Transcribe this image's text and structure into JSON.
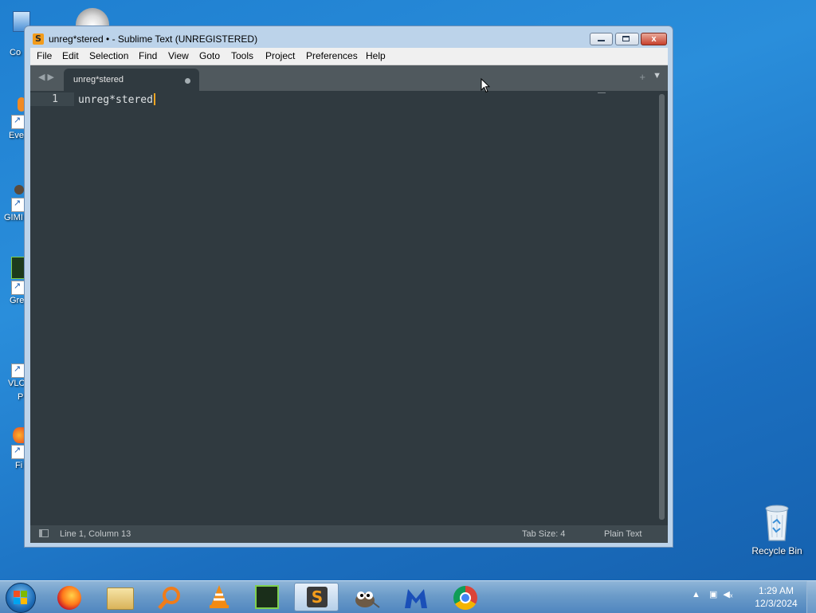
{
  "desktop": {
    "left_icons": [
      {
        "label": "Co",
        "icon": "computer-icon"
      },
      {
        "label": "Eve",
        "icon": "everything-icon"
      },
      {
        "label": "GIMI",
        "icon": "gimp-icon"
      },
      {
        "label": "Gre",
        "icon": "greenshot-icon"
      },
      {
        "label": "VLC",
        "label2": "P",
        "icon": "vlc-icon"
      },
      {
        "label": "Fi",
        "icon": "firefox-icon"
      }
    ],
    "recycle_bin": {
      "label": "Recycle Bin",
      "icon": "recycle-bin-icon"
    }
  },
  "window": {
    "title": "unreg*stered • - Sublime Text (UNREGISTERED)",
    "close_glyph": "x"
  },
  "menu": [
    "File",
    "Edit",
    "Selection",
    "Find",
    "View",
    "Goto",
    "Tools",
    "Project",
    "Preferences",
    "Help"
  ],
  "tabs": [
    {
      "label": "unreg*stered",
      "dirty": true
    }
  ],
  "editor": {
    "line_number": "1",
    "line_text": "unreg*stered"
  },
  "status": {
    "position": "Line 1, Column 13",
    "tab_size": "Tab Size: 4",
    "syntax": "Plain Text"
  },
  "taskbar": {
    "apps": [
      "firefox",
      "file-explorer",
      "search-everything",
      "vlc",
      "greenshot",
      "sublime-text",
      "gimp",
      "malwarebytes",
      "chrome"
    ],
    "active_app": "sublime-text"
  },
  "clock": {
    "time": "1:29 AM",
    "date": "12/3/2024"
  },
  "colors": {
    "editor_bg": "#303a40",
    "caret": "#f5a623",
    "tab_active": "#303a40",
    "taskbar": "#6c9cc9"
  }
}
